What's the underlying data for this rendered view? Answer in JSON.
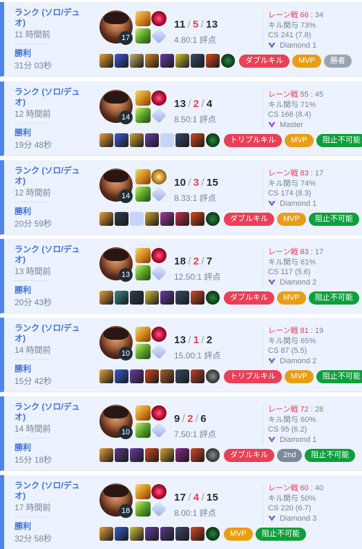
{
  "colors": {
    "accent": "#5383e8",
    "win_text": "#4171d6",
    "death": "#e84057",
    "card_bg": "#ecf2ff"
  },
  "matches": [
    {
      "queue": "ランク (ソロ/デュオ)",
      "ago": "11 時間前",
      "result": "勝利",
      "duration": "31分 03秒",
      "level": "17",
      "kills": "11",
      "deaths": "5",
      "assists": "13",
      "ratio": "4.80:1 評点",
      "lane_label": "レーン戦 66",
      "lane_vs": " : 34",
      "kp": "キル関与 73%",
      "cs": "CS 241 (7.8)",
      "tier": "Diamond 1",
      "tier_icon": "diamond-icon",
      "keystone": "electrocute",
      "items": [
        "#e9a13b",
        "#3b5bd6",
        "#c9b26a",
        "#d98a2a",
        "#6b3ca8",
        "#d9c23a",
        "#3a4a6a",
        "#d84a20",
        "#1f8a3a"
      ],
      "badges": [
        {
          "label": "ダブルキル",
          "type": "multi"
        },
        {
          "label": "MVP",
          "type": "mvp"
        },
        {
          "label": "勝者",
          "type": "win"
        }
      ]
    },
    {
      "queue": "ランク (ソロ/デュオ)",
      "ago": "12 時間前",
      "result": "勝利",
      "duration": "19分 48秒",
      "level": "14",
      "kills": "13",
      "deaths": "2",
      "assists": "4",
      "ratio": "8.50:1 評点",
      "lane_label": "レーン戦 55",
      "lane_vs": " : 45",
      "kp": "キル関与 71%",
      "cs": "CS 166 (8.4)",
      "tier": "Master",
      "tier_icon": "master-icon",
      "keystone": "electrocute",
      "items": [
        "#e9a13b",
        "#3b5bd6",
        "#d9a33a",
        "#6b3ca8",
        "EMPTY",
        "#3a4a6a",
        "#d84a20",
        "#1f8a3a"
      ],
      "badges": [
        {
          "label": "トリプルキル",
          "type": "multi"
        },
        {
          "label": "MVP",
          "type": "mvp"
        },
        {
          "label": "阻止不可能",
          "type": "unst"
        }
      ]
    },
    {
      "queue": "ランク (ソロ/デュオ)",
      "ago": "12 時間前",
      "result": "勝利",
      "duration": "20分 59秒",
      "level": "14",
      "kills": "10",
      "deaths": "3",
      "assists": "15",
      "ratio": "8.33:1 評点",
      "lane_label": "レーン戦 83",
      "lane_vs": " : 17",
      "kp": "キル関与 74%",
      "cs": "CS 174 (8.3)",
      "tier": "Diamond 1",
      "tier_icon": "diamond-icon",
      "keystone": "precision",
      "items": [
        "#e9a13b",
        "#2f3e4e",
        "EMPTY",
        "#d9a33a",
        "#a23aa0",
        "#c8304a",
        "#d84a20",
        "#1f8a3a"
      ],
      "badges": [
        {
          "label": "ダブルキル",
          "type": "multi"
        },
        {
          "label": "MVP",
          "type": "mvp"
        },
        {
          "label": "阻止不可能",
          "type": "unst"
        }
      ]
    },
    {
      "queue": "ランク (ソロ/デュオ)",
      "ago": "13 時間前",
      "result": "勝利",
      "duration": "20分 43秒",
      "level": "13",
      "kills": "18",
      "deaths": "2",
      "assists": "7",
      "ratio": "12.50:1 評点",
      "lane_label": "レーン戦 83",
      "lane_vs": " : 17",
      "kp": "キル関与 61%",
      "cs": "CS 117 (5.6)",
      "tier": "Diamond 2",
      "tier_icon": "diamond-icon",
      "keystone": "electrocute",
      "items": [
        "#e9a13b",
        "#3a8a8a",
        "#2f3e4e",
        "#d9c23a",
        "#6b3ca8",
        "#3a4a6a",
        "#d84a20",
        "#1f8a3a"
      ],
      "badges": [
        {
          "label": "ダブルキル",
          "type": "multi"
        },
        {
          "label": "MVP",
          "type": "mvp"
        },
        {
          "label": "阻止不可能",
          "type": "unst"
        }
      ]
    },
    {
      "queue": "ランク (ソロ/デュオ)",
      "ago": "14 時間前",
      "result": "勝利",
      "duration": "15分 42秒",
      "level": "10",
      "kills": "13",
      "deaths": "1",
      "assists": "2",
      "ratio": "15.00:1 評点",
      "lane_label": "レーン戦 81",
      "lane_vs": " : 19",
      "kp": "キル関与 65%",
      "cs": "CS 87 (5.5)",
      "tier": "Diamond 2",
      "tier_icon": "diamond-icon",
      "keystone": "electrocute",
      "items": [
        "#e9a13b",
        "#3b5bd6",
        "#6b3ca8",
        "#d84a20",
        "#a8642a",
        "#3a4a6a",
        "#c8402a",
        "#8a8a8a"
      ],
      "badges": [
        {
          "label": "トリプルキル",
          "type": "multi"
        },
        {
          "label": "MVP",
          "type": "mvp"
        },
        {
          "label": "阻止不可能",
          "type": "unst"
        }
      ]
    },
    {
      "queue": "ランク (ソロ/デュオ)",
      "ago": "14 時間前",
      "result": "勝利",
      "duration": "15分 18秒",
      "level": "10",
      "kills": "9",
      "deaths": "2",
      "assists": "6",
      "ratio": "7.50:1 評点",
      "lane_label": "レーン戦 72",
      "lane_vs": " : 28",
      "kp": "キル関与 60%",
      "cs": "CS 95 (6.2)",
      "tier": "Diamond 1",
      "tier_icon": "diamond-icon",
      "keystone": "electrocute",
      "items": [
        "#e9a13b",
        "#5a3a8a",
        "#6b3ca8",
        "#d84a20",
        "#d9a33a",
        "#8a2a8a",
        "#d84a20",
        "#8a8a8a"
      ],
      "badges": [
        {
          "label": "ダブルキル",
          "type": "multi"
        },
        {
          "label": "2nd",
          "type": "2nd"
        },
        {
          "label": "阻止不可能",
          "type": "unst"
        }
      ]
    },
    {
      "queue": "ランク (ソロ/デュオ)",
      "ago": "17 時間前",
      "result": "勝利",
      "duration": "32分 58秒",
      "level": "18",
      "kills": "17",
      "deaths": "4",
      "assists": "15",
      "ratio": "8.00:1 評点",
      "lane_label": "レーン戦 60",
      "lane_vs": " : 40",
      "kp": "キル関与 50%",
      "cs": "CS 220 (6.7)",
      "tier": "Diamond 3",
      "tier_icon": "diamond-icon",
      "keystone": "electrocute",
      "items": [
        "#e9a13b",
        "#3b5bd6",
        "#d9c23a",
        "#6b3ca8",
        "#5a3a8a",
        "#3a4a6a",
        "#d84a20",
        "#1f8a3a"
      ],
      "badges": [
        {
          "label": "MVP",
          "type": "mvp"
        },
        {
          "label": "阻止不可能",
          "type": "unst"
        }
      ]
    }
  ]
}
